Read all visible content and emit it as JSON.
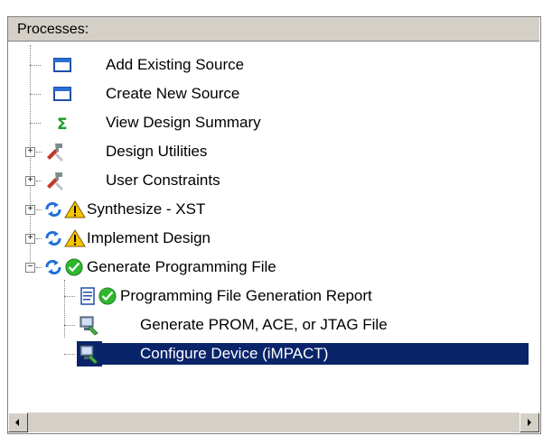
{
  "panel": {
    "title": "Processes:"
  },
  "tree": {
    "items": [
      {
        "label": "Add Existing Source",
        "icon": "source-window-icon"
      },
      {
        "label": "Create New Source",
        "icon": "source-window-icon"
      },
      {
        "label": "View Design Summary",
        "icon": "sigma-icon"
      },
      {
        "label": "Design Utilities",
        "icon": "tools-icon"
      },
      {
        "label": "User Constraints",
        "icon": "tools-icon"
      },
      {
        "label": "Synthesize - XST",
        "icon": "warning-icon",
        "status": "warning"
      },
      {
        "label": "Implement Design",
        "icon": "warning-icon",
        "status": "warning"
      },
      {
        "label": "Generate Programming File",
        "icon": "check-icon",
        "status": "ok"
      },
      {
        "label": "Programming File Generation Report",
        "icon": "report-icon",
        "status": "ok"
      },
      {
        "label": "Generate PROM, ACE, or JTAG File",
        "icon": "device-icon"
      },
      {
        "label": "Configure Device (iMPACT)",
        "icon": "device-icon",
        "selected": true
      }
    ]
  },
  "colors": {
    "selection": "#0a246a",
    "warning": "#f5c400",
    "ok": "#2eb82e",
    "sync": "#1e6fd9"
  }
}
